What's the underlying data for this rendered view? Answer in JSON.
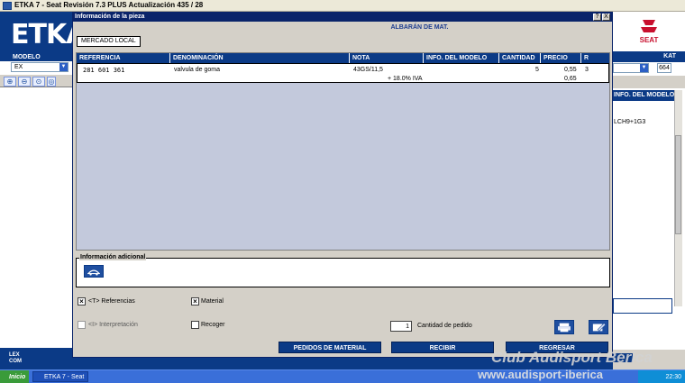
{
  "window": {
    "title": "ETKA 7 - Seat Revisión 7.3 PLUS Actualización 435 / 28"
  },
  "left": {
    "logo": "ETKA",
    "modelo_label": "MODELO",
    "modelo_value": "EX",
    "lexcom": [
      "LEX",
      "COM"
    ]
  },
  "right": {
    "brand": "SEAT",
    "kat_label": "KAT",
    "kat_value": "664",
    "column_header": "INFO. DEL MODELO",
    "cell_value": "LCH9+1G3"
  },
  "dialog": {
    "title": "Información de la pieza",
    "help": "?",
    "close": "X",
    "subtitle": "ALBARÁN DE MAT.",
    "tab": "MERCADO LOCAL",
    "columns": [
      "REFERENCIA",
      "DENOMINACIÓN",
      "NOTA",
      "INFO. DEL MODELO",
      "CANTIDAD",
      "PRECIO",
      "R"
    ],
    "row": {
      "referencia": "281 601 361",
      "denominacion": "valvula de goma",
      "nota": "43GS/11,5",
      "nota_iva": "+ 18.0% IVA",
      "info_modelo": "",
      "cantidad": "5",
      "precio": "0,55",
      "precio_iva": "0,65",
      "r": "3"
    },
    "info_adicional_label": "Información adicional",
    "options": {
      "referencias": {
        "label": "<T> Referencias",
        "checked": true
      },
      "material": {
        "label": "Material",
        "checked": true
      },
      "interpretacion": {
        "label": "<I> Interpretación",
        "checked": false
      },
      "recoger": {
        "label": "Recoger",
        "checked": false
      }
    },
    "quantity": {
      "value": "1",
      "label": "Cantidad de pedido"
    },
    "buttons": {
      "pedidos": "PEDIDOS DE MATERIAL",
      "recibir": "RECIBIR",
      "regresar": "REGRESAR"
    }
  },
  "taskbar": {
    "start": "Inicio",
    "app": "ETKA 7 - Seat",
    "clock": "22:30"
  },
  "watermark": {
    "line1": "Club Audisport Bérica",
    "line2": "www.audisport-iberica"
  }
}
